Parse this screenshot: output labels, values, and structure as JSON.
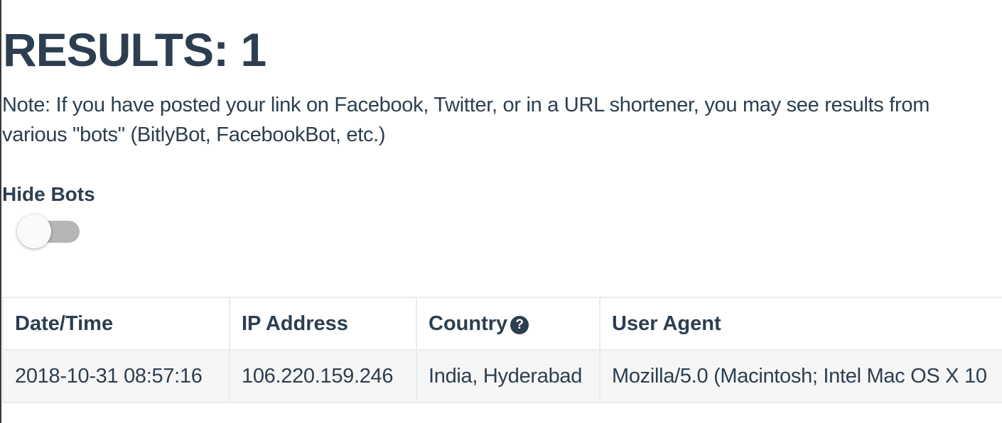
{
  "header": {
    "title": "RESULTS: 1"
  },
  "note": {
    "text": "Note: If you have posted your link on Facebook, Twitter, or in a URL shortener, you may see results from various \"bots\" (BitlyBot, FacebookBot, etc.)"
  },
  "filters": {
    "hide_bots_label": "Hide Bots",
    "hide_bots_enabled": false
  },
  "table": {
    "columns": [
      "Date/Time",
      "IP Address",
      "Country",
      "User Agent"
    ],
    "country_help_icon": "question-circle-icon",
    "help_glyph": "?",
    "rows": [
      {
        "datetime": "2018-10-31 08:57:16",
        "ip": "106.220.159.246",
        "country": "India, Hyderabad",
        "user_agent": "Mozilla/5.0 (Macintosh; Intel Mac OS X 10"
      }
    ]
  },
  "colors": {
    "text": "#2c3e50",
    "toggle_track_off": "#b6b6b6",
    "row_background": "#f6f6f6",
    "border": "#e9ecef"
  }
}
